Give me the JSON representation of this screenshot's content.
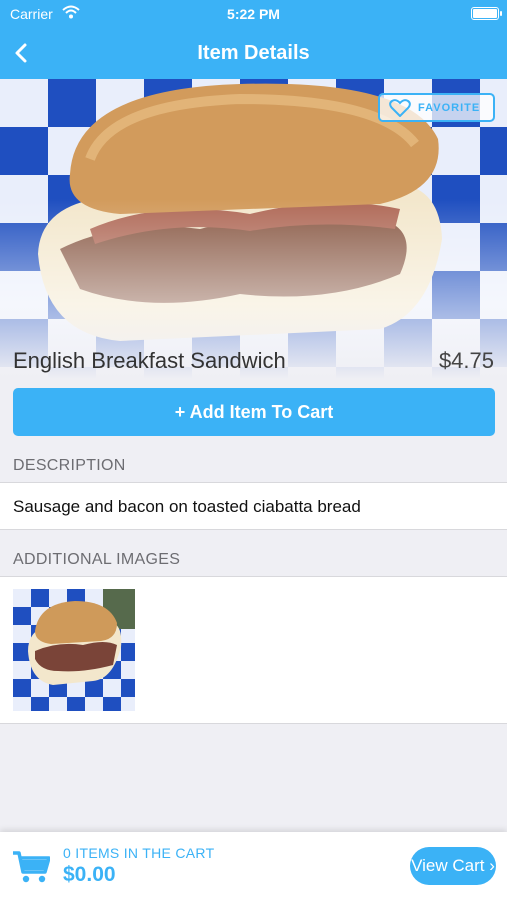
{
  "status_bar": {
    "carrier": "Carrier",
    "time": "5:22 PM"
  },
  "nav": {
    "title": "Item Details"
  },
  "hero": {
    "favorite_label": "FAVORITE"
  },
  "item": {
    "name": "English Breakfast Sandwich",
    "price": "$4.75"
  },
  "actions": {
    "add_to_cart": "+ Add Item To Cart"
  },
  "description": {
    "header": "DESCRIPTION",
    "text": "Sausage and bacon on toasted ciabatta bread"
  },
  "additional_images": {
    "header": "ADDITIONAL IMAGES"
  },
  "cart": {
    "count_text": "0 ITEMS IN THE CART",
    "total": "$0.00",
    "view_label": "View Cart ›"
  },
  "colors": {
    "accent": "#3bb2f6",
    "background": "#efeff4"
  },
  "icons": [
    "wifi-icon",
    "battery-icon",
    "back-chevron-icon",
    "heart-icon",
    "cart-icon"
  ]
}
